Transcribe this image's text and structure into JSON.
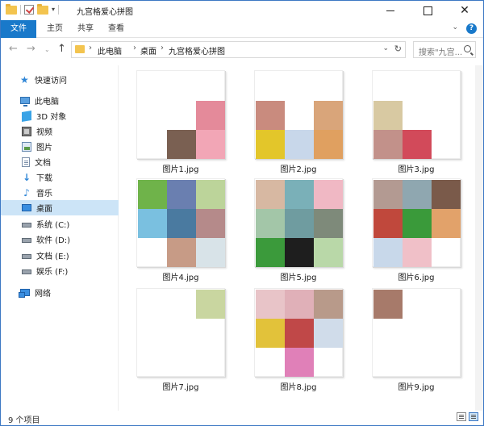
{
  "window": {
    "title": "九宫格爱心拼图",
    "controls": [
      "minimize",
      "maximize",
      "close"
    ]
  },
  "ribbon": {
    "tabs": [
      "文件",
      "主页",
      "共享",
      "查看"
    ],
    "active_tab": "文件",
    "accent": "#1979ca"
  },
  "address": {
    "breadcrumbs": [
      "此电脑",
      "桌面",
      "九宫格爱心拼图"
    ],
    "search_placeholder": "搜索\"九宫..."
  },
  "sidebar": {
    "items": [
      {
        "label": "快速访问",
        "icon": "star-icon"
      },
      {
        "label": "此电脑",
        "icon": "computer-icon"
      },
      {
        "label": "3D 对象",
        "icon": "3d-objects-icon"
      },
      {
        "label": "视频",
        "icon": "video-icon"
      },
      {
        "label": "图片",
        "icon": "pictures-icon"
      },
      {
        "label": "文档",
        "icon": "documents-icon"
      },
      {
        "label": "下载",
        "icon": "download-icon"
      },
      {
        "label": "音乐",
        "icon": "music-icon"
      },
      {
        "label": "桌面",
        "icon": "desktop-icon",
        "selected": true
      },
      {
        "label": "系统 (C:)",
        "icon": "drive-icon"
      },
      {
        "label": "软件 (D:)",
        "icon": "drive-icon"
      },
      {
        "label": "文档 (E:)",
        "icon": "drive-icon"
      },
      {
        "label": "娱乐 (F:)",
        "icon": "drive-icon"
      },
      {
        "label": "网络",
        "icon": "network-icon"
      }
    ]
  },
  "files": [
    {
      "name": "图片1.jpg",
      "cells": [
        0,
        0,
        0,
        0,
        0,
        1,
        0,
        1,
        1
      ],
      "colors": [
        "",
        "",
        "",
        "",
        "",
        "#e48a9a",
        "",
        "#7a6052",
        "#f2a6b6"
      ]
    },
    {
      "name": "图片2.jpg",
      "cells": [
        0,
        0,
        0,
        1,
        0,
        1,
        1,
        1,
        1
      ],
      "colors": [
        "",
        "",
        "",
        "#c98b7e",
        "",
        "#d9a57a",
        "#e3c62a",
        "#c8d7ea",
        "#e0a060"
      ]
    },
    {
      "name": "图片3.jpg",
      "cells": [
        0,
        0,
        0,
        1,
        0,
        0,
        1,
        1,
        0
      ],
      "colors": [
        "",
        "",
        "",
        "#d8c9a2",
        "",
        "",
        "#c2918a",
        "#d24a5a",
        ""
      ]
    },
    {
      "name": "图片4.jpg",
      "cells": [
        1,
        1,
        1,
        1,
        1,
        1,
        0,
        1,
        1
      ],
      "colors": [
        "#6fb34a",
        "#6a7fb0",
        "#bcd49a",
        "#7ac0e0",
        "#4a7aa0",
        "#b58a8a",
        "",
        "#c79b86",
        "#d8e3e8"
      ]
    },
    {
      "name": "图片5.jpg",
      "cells": [
        1,
        1,
        1,
        1,
        1,
        1,
        1,
        1,
        1
      ],
      "colors": [
        "#d7b8a2",
        "#7ab0b8",
        "#f0b8c4",
        "#a3c6a8",
        "#6f9ca0",
        "#7e8a7a",
        "#3b9a3b",
        "#1e1e1e",
        "#b9d8a8"
      ]
    },
    {
      "name": "图片6.jpg",
      "cells": [
        1,
        1,
        1,
        1,
        1,
        1,
        1,
        1,
        0
      ],
      "colors": [
        "#b39a92",
        "#8fa7b0",
        "#7a5a4a",
        "#c0483c",
        "#3a9a3a",
        "#e2a26a",
        "#c8d8ea",
        "#f0c0c8",
        ""
      ]
    },
    {
      "name": "图片7.jpg",
      "cells": [
        0,
        0,
        1,
        0,
        0,
        0,
        0,
        0,
        0
      ],
      "colors": [
        "",
        "",
        "#c9d6a0",
        "",
        "",
        "",
        "",
        "",
        ""
      ]
    },
    {
      "name": "图片8.jpg",
      "cells": [
        1,
        1,
        1,
        1,
        1,
        1,
        0,
        1,
        0
      ],
      "colors": [
        "#e8c4c8",
        "#e0b0b8",
        "#b89a8a",
        "#e2c23a",
        "#c04848",
        "#d0dcea",
        "",
        "#e080b8",
        ""
      ]
    },
    {
      "name": "图片9.jpg",
      "cells": [
        1,
        0,
        0,
        0,
        0,
        0,
        0,
        0,
        0
      ],
      "colors": [
        "#a77a6a",
        "",
        "",
        "",
        "",
        "",
        "",
        "",
        ""
      ]
    }
  ],
  "status": {
    "count_text": "9 个项目"
  }
}
